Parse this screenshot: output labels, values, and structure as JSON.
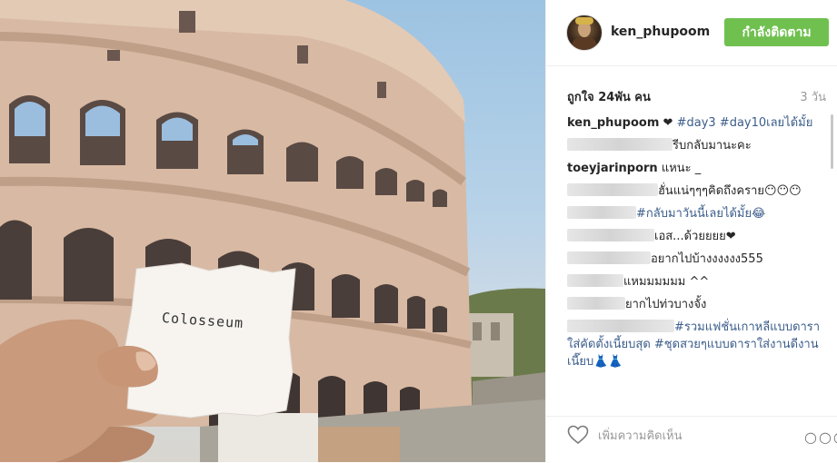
{
  "post": {
    "username": "ken_phupoom",
    "follow_label": "กำลังติดตาม",
    "likes": "ถูกใจ 24พัน คน",
    "time_ago": "3 วัน",
    "photo_note": "Colosseum",
    "add_comment_placeholder": "เพิ่มความคิดเห็น",
    "more_label": "○○○"
  },
  "comments": [
    {
      "user": "ken_phupoom",
      "text": "❤",
      "tags": "#day3 #day10เลยได้มั้ย",
      "blur_width": 0
    },
    {
      "user": "",
      "text": "รีบกลับมานะคะ",
      "tags": "",
      "blur_width": 116
    },
    {
      "user": "toeyjarinporn",
      "text": "แหนะ _",
      "tags": "",
      "blur_width": 0
    },
    {
      "user": "",
      "text": "ฮั่นแน่ๆๆๆคิดถึงคราย😶😶😶",
      "tags": "",
      "blur_width": 100
    },
    {
      "user": "",
      "text": "",
      "tags": "#กลับมาวันนี้เลยได้มั้ย😂",
      "blur_width": 76
    },
    {
      "user": "",
      "text": "เอส...ด้วยยยย❤",
      "tags": "",
      "blur_width": 96
    },
    {
      "user": "",
      "text": "อยากไปบ้างงงงงง555",
      "tags": "",
      "blur_width": 92
    },
    {
      "user": "",
      "text": "แหมมมมมม ^^",
      "tags": "",
      "blur_width": 62
    },
    {
      "user": "",
      "text": "ยากไปท่วบางจั้ง",
      "tags": "",
      "blur_width": 64
    },
    {
      "user": "",
      "text": "",
      "tags": "#รวมแฟชั่นเกาหลีแบบดาราใส่คัดตั้งเนี้ยบสุด #ชุดสวยๆแบบดาราใส่งานดีงานเนี๊ยบ👗👗",
      "blur_width": 118
    }
  ]
}
